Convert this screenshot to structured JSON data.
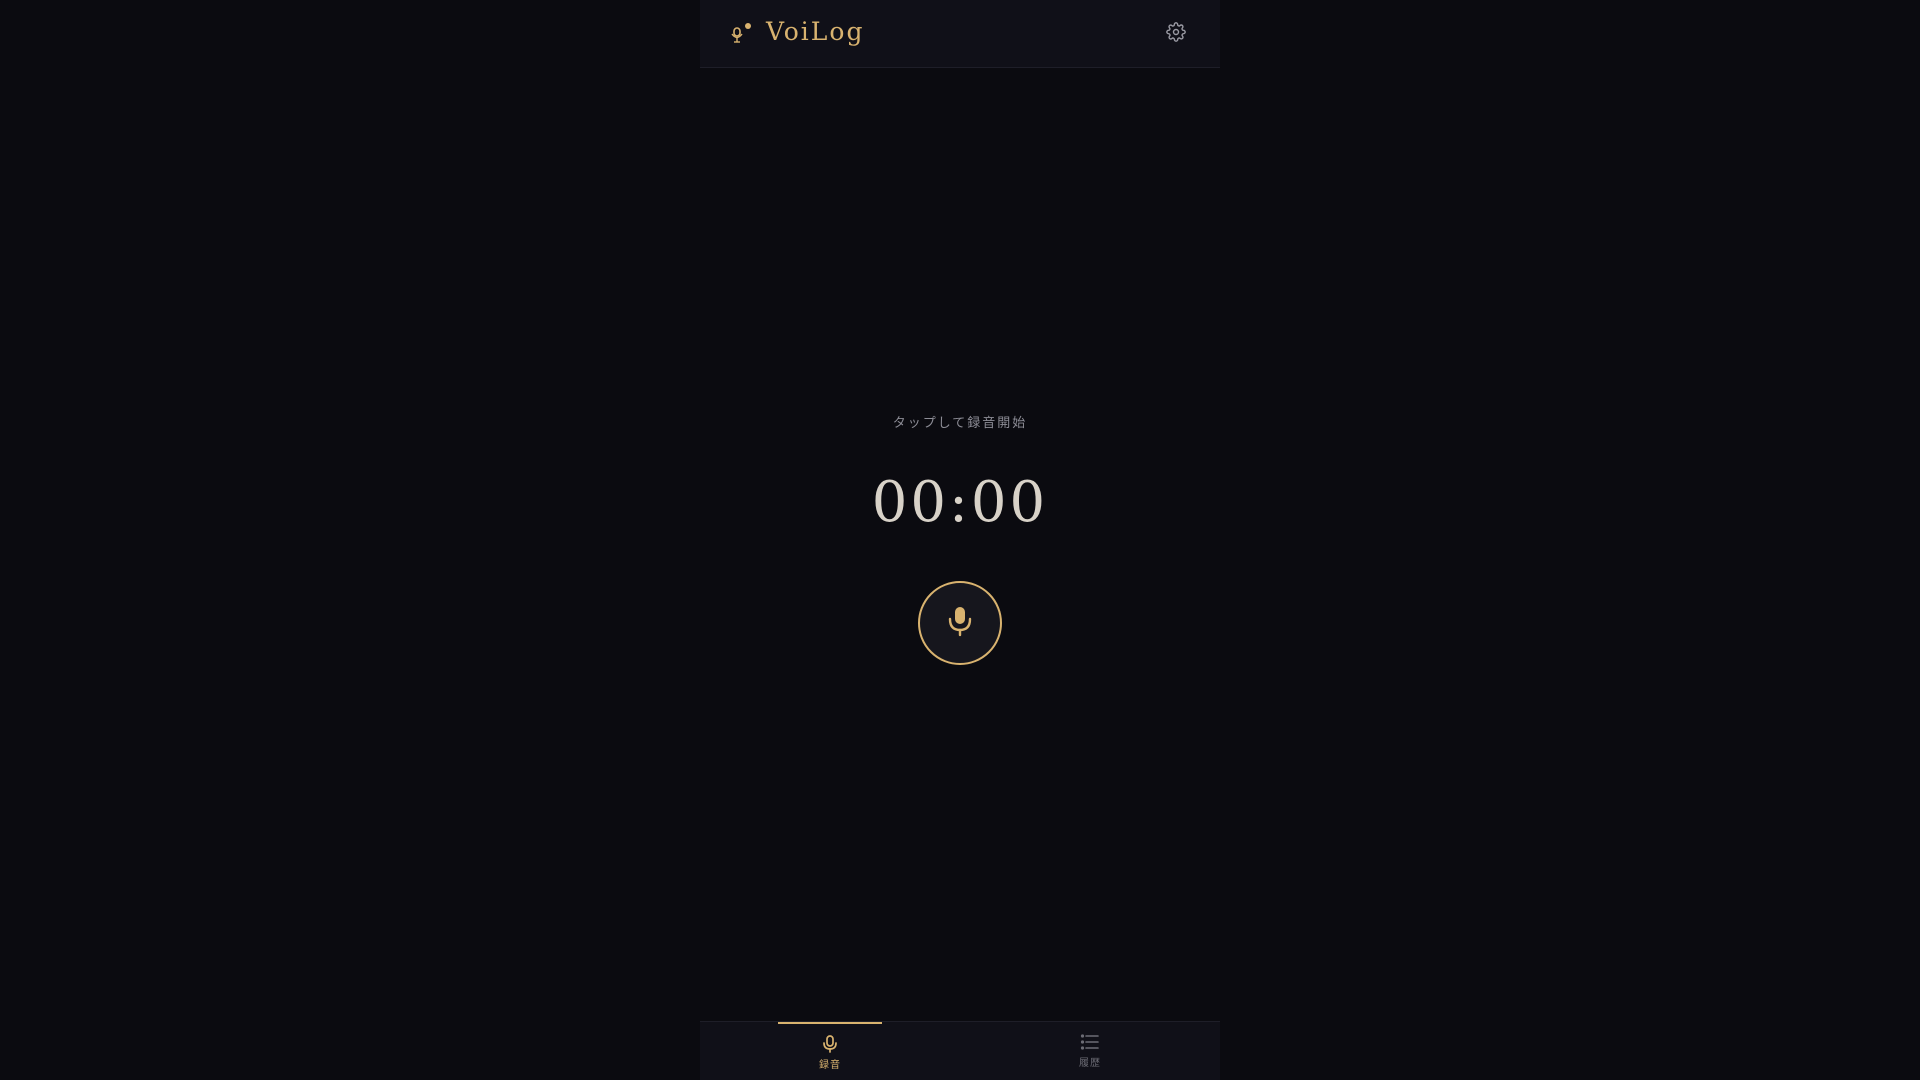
{
  "header": {
    "title": "VoiLog",
    "logo_icon": "mic-sparkle-icon",
    "settings_icon": "gear-icon"
  },
  "main": {
    "hint": "タップして録音開始",
    "timer": "00:00",
    "record_icon": "microphone-icon"
  },
  "nav": {
    "items": [
      {
        "label": "録音",
        "icon": "microphone-icon",
        "active": true
      },
      {
        "label": "履歴",
        "icon": "list-icon",
        "active": false
      }
    ]
  },
  "colors": {
    "background": "#0b0b10",
    "accent": "#d9b36f",
    "text_muted": "#8d8d96"
  }
}
